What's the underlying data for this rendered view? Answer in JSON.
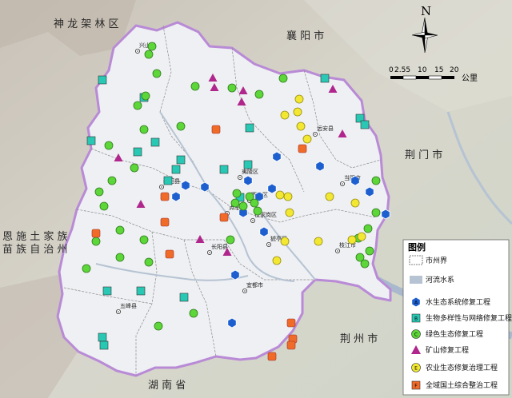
{
  "outer_labels": {
    "northwest": "神 龙 架 林 区",
    "north": "襄 阳 市",
    "east": "荆 门 市",
    "west_line1": "恩 施 土 家 族",
    "west_line2": "苗 族 自 治 州",
    "south": "湖 南 省",
    "southeast": "荆 州 市"
  },
  "compass": {
    "letter": "N"
  },
  "scale_bar": {
    "ticks": [
      "0",
      "2.55",
      "10",
      "15",
      "20"
    ],
    "unit": "公里"
  },
  "county_labels": [
    {
      "name": "兴山县"
    },
    {
      "name": "远安县"
    },
    {
      "name": "夷陵区"
    },
    {
      "name": "当阳市"
    },
    {
      "name": "秭归县"
    },
    {
      "name": "西陵区"
    },
    {
      "name": "点军区"
    },
    {
      "name": "伍家岗区"
    },
    {
      "name": "猇亭区"
    },
    {
      "name": "长阳县"
    },
    {
      "name": "枝江市"
    },
    {
      "name": "宜都市"
    },
    {
      "name": "五峰县"
    }
  ],
  "legend": {
    "title": "图例",
    "items": [
      {
        "symbol": "boundary",
        "label": "市州界"
      },
      {
        "symbol": "river",
        "label": "河流水系"
      },
      {
        "symbol": "hexagon",
        "letter": "A",
        "label": "水生态系统修复工程",
        "color": "#1e5fd0"
      },
      {
        "symbol": "square",
        "letter": "B",
        "label": "生物多样性与网络修复工程",
        "color": "#28c8b4"
      },
      {
        "symbol": "circle",
        "letter": "C",
        "label": "绿色生态修复工程",
        "color": "#5cd638"
      },
      {
        "symbol": "triangle",
        "label": "矿山修复工程",
        "color": "#b0268c"
      },
      {
        "symbol": "circle",
        "letter": "E",
        "label": "农业生态修复治理工程",
        "color": "#f2e832"
      },
      {
        "symbol": "square",
        "letter": "F",
        "label": "全域国土综合整治工程",
        "color": "#f06a28"
      }
    ]
  }
}
